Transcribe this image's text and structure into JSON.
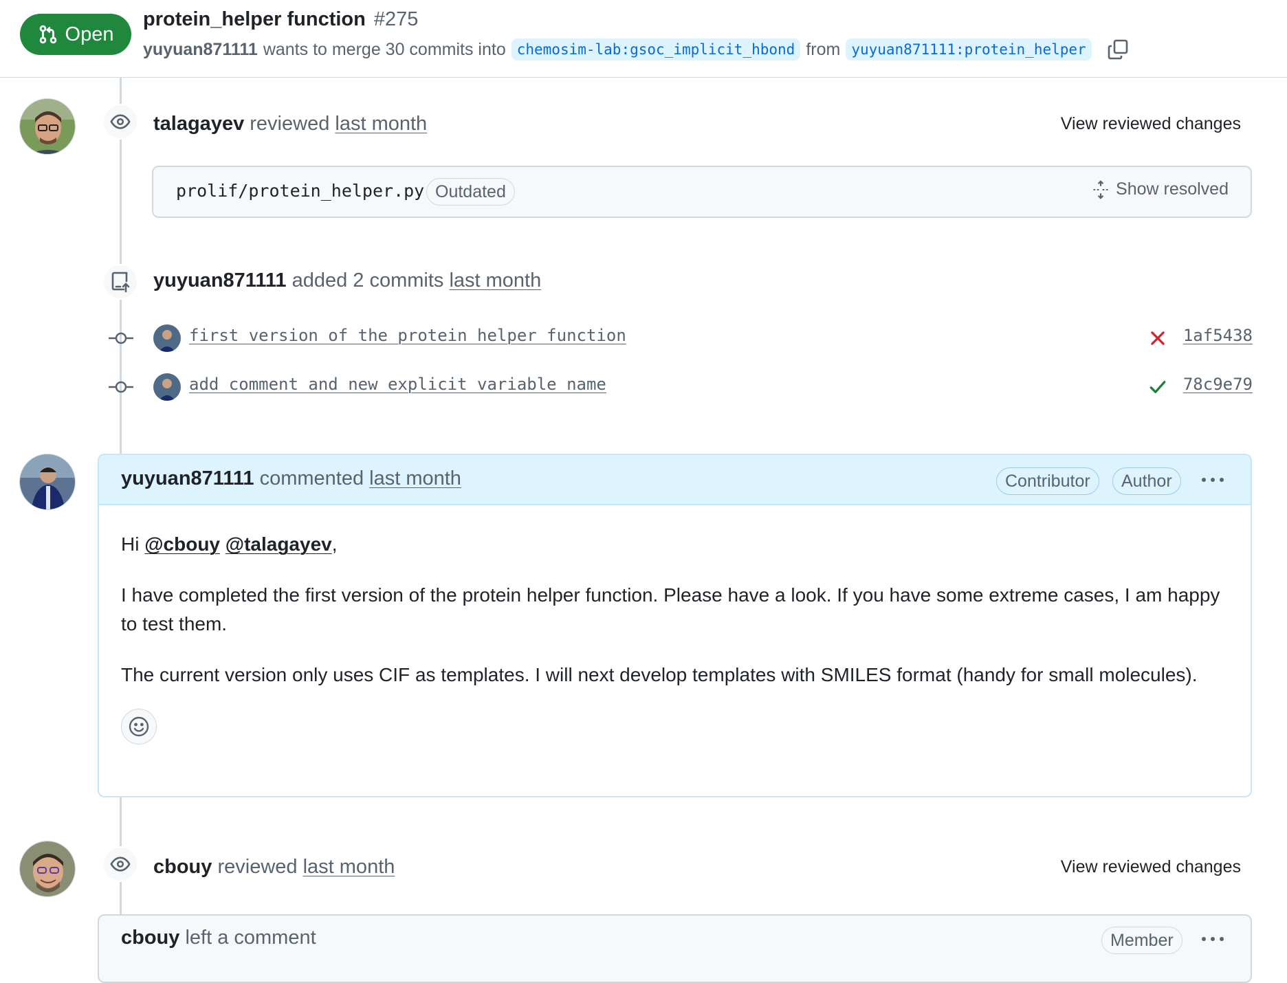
{
  "header": {
    "state": "Open",
    "title": "protein_helper function",
    "number": "#275",
    "author": "yuyuan871111",
    "merge_text": "wants to merge 30 commits into",
    "base_branch": "chemosim-lab:gsoc_implicit_hbond",
    "from_text": "from",
    "head_branch": "yuyuan871111:protein_helper"
  },
  "review1": {
    "user": "talagayev",
    "action": "reviewed",
    "time": "last month",
    "view_changes": "View reviewed changes",
    "file_path": "prolif/protein_helper.py",
    "outdated": "Outdated",
    "show_resolved": "Show resolved"
  },
  "commits_event": {
    "user": "yuyuan871111",
    "action": "added 2 commits",
    "time": "last month",
    "commits": [
      {
        "message": "first version of the protein helper function",
        "sha": "1af5438",
        "status": "failure"
      },
      {
        "message": "add comment and new explicit variable name",
        "sha": "78c9e79",
        "status": "success"
      }
    ]
  },
  "comment1": {
    "user": "yuyuan871111",
    "action": "commented",
    "time": "last month",
    "labels": [
      "Contributor",
      "Author"
    ],
    "greeting": "Hi",
    "mentions": [
      "@cbouy",
      "@talagayev"
    ],
    "comma": ",",
    "para1": "I have completed the first version of the protein helper function. Please have a look. If you have some extreme cases, I am happy to test them.",
    "para2": "The current version only uses CIF as templates. I will next develop templates with SMILES format (handy for small molecules)."
  },
  "review2": {
    "user": "cbouy",
    "action": "reviewed",
    "time": "last month",
    "view_changes": "View reviewed changes"
  },
  "comment2": {
    "user": "cbouy",
    "action": "left a comment",
    "label": "Member"
  },
  "icons": [
    "git-pull-request-icon",
    "copy-icon",
    "eye-icon",
    "repo-push-icon",
    "git-commit-icon",
    "x-icon",
    "check-icon",
    "kebab-horizontal-icon",
    "smiley-icon",
    "unfold-icon"
  ],
  "colors": {
    "open_green": "#1f883d",
    "branch_bg": "#ddf4ff",
    "branch_fg": "#0969da",
    "fail_red": "#d1242f",
    "success_green": "#1a7f37",
    "comment_head": "#ddf4ff"
  }
}
